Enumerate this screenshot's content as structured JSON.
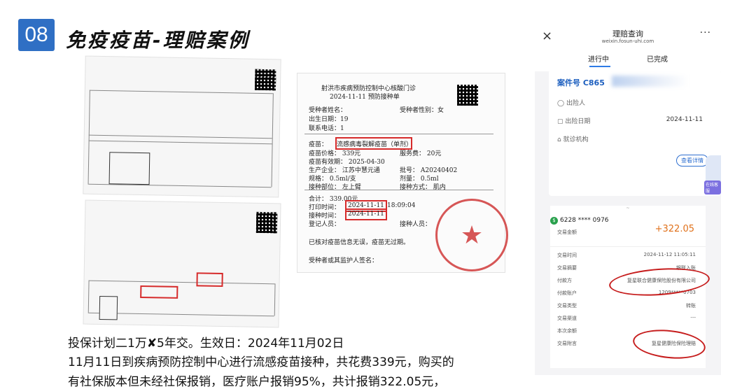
{
  "slide": {
    "number": "08",
    "title": "免疫疫苗-理赔案例"
  },
  "vaccine_doc": {
    "title_line1": "射洪市疾病预防控制中心核酸门诊",
    "title_line2": "2024-11-11    预防接种单",
    "name_label": "受种者姓名：",
    "gender": "受种者性别：女",
    "dob_label": "出生日期：19",
    "phone_label": "联系电话：1",
    "vaccine_label": "疫苗：",
    "vaccine_name": "流感病毒裂解疫苗（单剂）",
    "price": "疫苗价格：  339元",
    "service_fee": "服务费：  20元",
    "expiry": "疫苗有效期：  2025-04-30",
    "maker": "生产企业：  江苏中慧元通",
    "batch": "批号：  A20240402",
    "spec": "规格：  0.5ml/支",
    "dose": "剂量：  0.5ml",
    "site": "接种部位：  左上臂",
    "route": "接种方式：  肌内",
    "total": "合计：  339.00元",
    "print_time_label": "打印时间：",
    "print_time": "2024-11-11",
    "print_time_suffix": "18:09:04",
    "vacc_time_label": "接种时间：",
    "vacc_time": "2024-11-11",
    "registrar": "登记人员：",
    "inoculator": "接种人员：",
    "confirm": "已核对疫苗信息无误，疫苗无过期。",
    "guardian": "受种者或其监护人签名："
  },
  "body": {
    "line1": "投保计划二1万✘5年交。生效日：2024年11月02日",
    "line2": "11月11日到疾病预防控制中心进行流感疫苗接种，共花费339元，购买的",
    "line3": "有社保版本但未经社保报销，医疗账户报销95%，共计报销322.05元，"
  },
  "phone": {
    "title": "理赔查询",
    "url": "weixin.fosun-uhi.com",
    "tabs": [
      "进行中",
      "已完成"
    ],
    "case_label": "案件号 C865",
    "insured_label": "出险人",
    "date_label": "出险日期",
    "date_value": "2024-11-11",
    "clinic_label": "就诊机构",
    "detail_button": "查看详情",
    "robot_tag": "在线客服",
    "account": "6228 **** 0976",
    "amount_label": "交易金额",
    "amount": "+322.05",
    "tx_rows": [
      {
        "label": "交易时间",
        "value": "2024-11-12 11:05:11"
      },
      {
        "label": "交易摘要",
        "value": "银联入账"
      },
      {
        "label": "付款方",
        "value": "复星联合健康保险股份有限公司"
      },
      {
        "label": "付款账户",
        "value": "1209*****0703"
      },
      {
        "label": "交易类型",
        "value": "转账"
      },
      {
        "label": "交易渠道",
        "value": "---"
      },
      {
        "label": "本次余额",
        "value": ""
      },
      {
        "label": "交易附言",
        "value": "复星健康险保险理赔"
      }
    ]
  }
}
